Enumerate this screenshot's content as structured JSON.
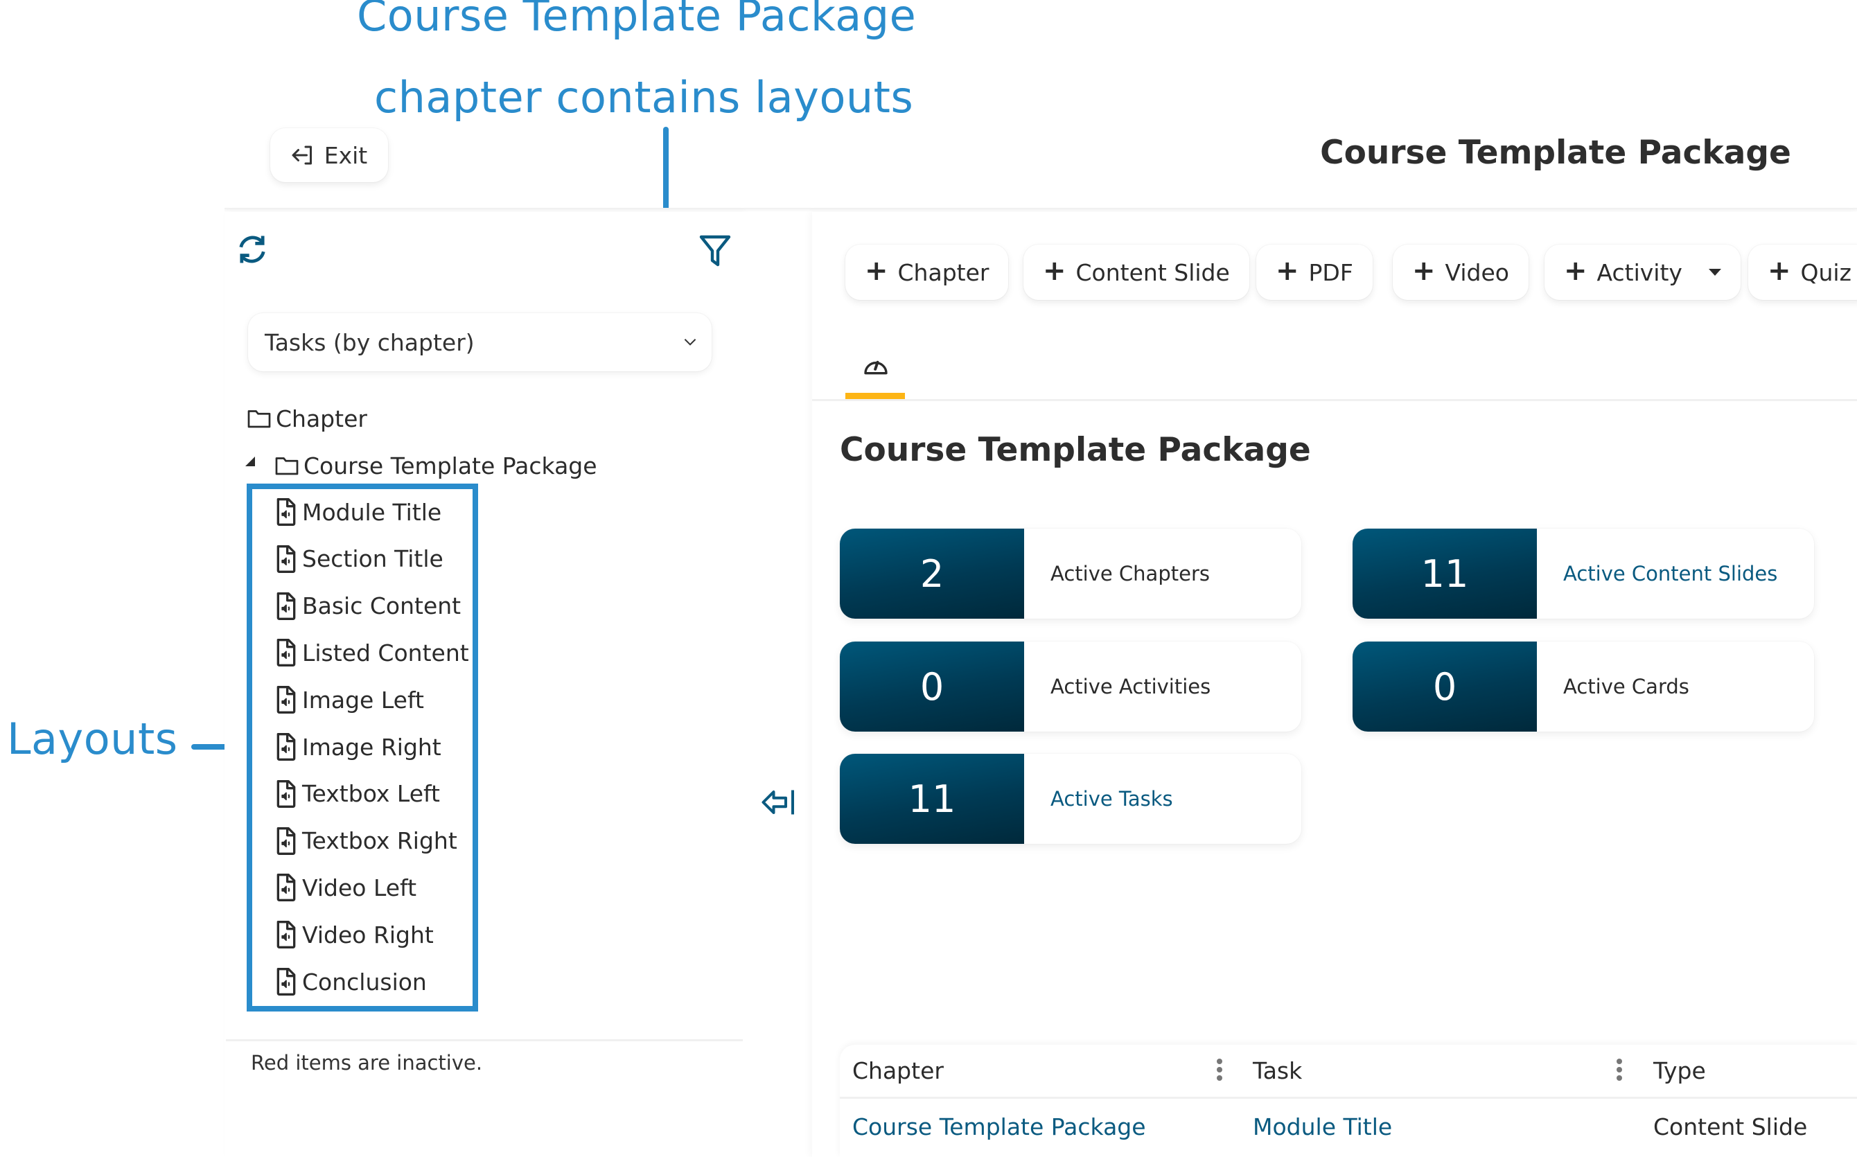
{
  "annotations": {
    "title_line1": "Course Template Package",
    "title_line2": "chapter contains layouts",
    "layouts_label": "Layouts",
    "color": "#2a8ccc"
  },
  "header": {
    "exit_label": "Exit",
    "title": "Course Template Package"
  },
  "sidebar": {
    "view_select": {
      "selected": "Tasks (by chapter)"
    },
    "tree": {
      "root": {
        "label": "Chapter",
        "icon": "folder-icon"
      },
      "chapter": {
        "label": "Course Template Package",
        "icon": "folder-icon",
        "expanded": true
      },
      "items": [
        {
          "label": "Module Title",
          "icon": "file-audio-icon"
        },
        {
          "label": "Section Title",
          "icon": "file-audio-icon"
        },
        {
          "label": "Basic Content",
          "icon": "file-audio-icon"
        },
        {
          "label": "Listed Content",
          "icon": "file-audio-icon"
        },
        {
          "label": "Image Left",
          "icon": "file-audio-icon"
        },
        {
          "label": "Image Right",
          "icon": "file-audio-icon"
        },
        {
          "label": "Textbox Left",
          "icon": "file-audio-icon"
        },
        {
          "label": "Textbox Right",
          "icon": "file-audio-icon"
        },
        {
          "label": "Video Left",
          "icon": "file-audio-icon"
        },
        {
          "label": "Video Right",
          "icon": "file-audio-icon"
        },
        {
          "label": "Conclusion",
          "icon": "file-audio-icon"
        }
      ]
    },
    "footnote": "Red items are inactive."
  },
  "toolbar": {
    "buttons": [
      {
        "label": "Chapter"
      },
      {
        "label": "Content Slide"
      },
      {
        "label": "PDF"
      },
      {
        "label": "Video"
      },
      {
        "label": "Activity",
        "has_dropdown": true
      },
      {
        "label": "Quiz"
      }
    ]
  },
  "tabs": [
    {
      "icon": "dashboard-gauge-icon",
      "active": true,
      "accent": "#fdb515"
    }
  ],
  "main": {
    "title": "Course Template Package",
    "stats": [
      {
        "value": "2",
        "label": "Active Chapters",
        "link": false
      },
      {
        "value": "11",
        "label": "Active Content Slides",
        "link": true
      },
      {
        "value": "0",
        "label": "Active Activities",
        "link": false
      },
      {
        "value": "0",
        "label": "Active Cards",
        "link": false
      },
      {
        "value": "11",
        "label": "Active Tasks",
        "link": true
      }
    ],
    "table": {
      "columns": [
        "Chapter",
        "Task",
        "Type"
      ],
      "rows": [
        [
          "Course Template Package",
          "Module Title",
          "Content Slide"
        ]
      ]
    }
  },
  "colors": {
    "brand_dark": "#003a54",
    "link": "#0a5a80",
    "icon": "#0a5a80",
    "tab_accent": "#fdb515"
  }
}
